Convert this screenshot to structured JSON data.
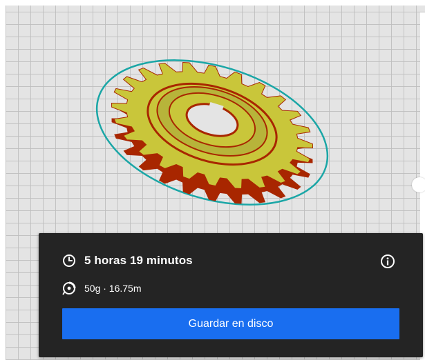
{
  "print_summary": {
    "print_time": "5 horas 19 minutos",
    "material_usage": "50g · 16.75m",
    "save_button_label": "Guardar en disco"
  },
  "icons": {
    "time": "clock-icon",
    "material": "filament-spool-icon",
    "info": "info-icon"
  },
  "colors": {
    "panel_background": "#242424",
    "save_button": "#196ef0",
    "gear_top": "#c9c63a",
    "gear_side": "#a82600",
    "outline": "#1aa6a6",
    "build_plate": "#e4e4e4"
  }
}
